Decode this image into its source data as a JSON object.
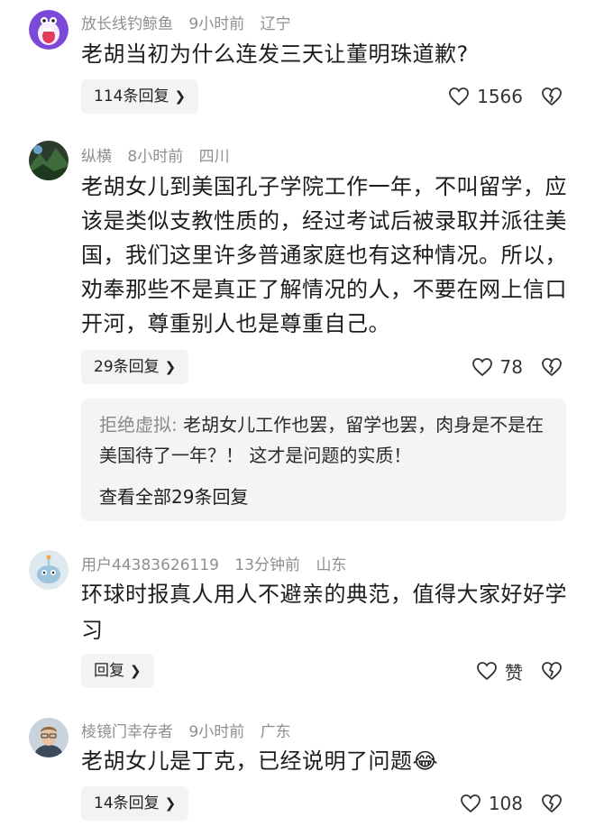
{
  "comments": [
    {
      "username": "放长线钓鲸鱼",
      "time": "9小时前",
      "location": "辽宁",
      "text": "老胡当初为什么连发三天让董明珠道歉?",
      "reply_label": "114条回复",
      "likes": "1566",
      "avatar": "purple-monster-avatar"
    },
    {
      "username": "纵横",
      "time": "8小时前",
      "location": "四川",
      "text": "老胡女儿到美国孔子学院工作一年，不叫留学，应该是类似支教性质的，经过考试后被录取并派往美国，我们这里许多普通家庭也有这种情况。所以，劝奉那些不是真正了解情况的人，不要在网上信口开河，尊重别人也是尊重自己。",
      "reply_label": "29条回复",
      "likes": "78",
      "avatar": "landscape-avatar",
      "sub_reply": {
        "author": "拒绝虚拟",
        "text": "老胡女儿工作也罢，留学也罢，肉身是不是在美国待了一年？！ 这才是问题的实质！",
        "view_all": "查看全部29条回复"
      }
    },
    {
      "username": "用户44383626119",
      "time": "13分钟前",
      "location": "山东",
      "text": "环球时报真人用人不避亲的典范，值得大家好好学习",
      "reply_label": "回复",
      "likes": "赞",
      "avatar": "default-alien-avatar"
    },
    {
      "username": "棱镜门幸存者",
      "time": "9小时前",
      "location": "广东",
      "text": "老胡女儿是丁克，已经说明了问题😂",
      "reply_label": "14条回复",
      "likes": "108",
      "avatar": "portrait-avatar"
    }
  ],
  "colors": {
    "meta": "#8f8f8f",
    "reply_bg": "#f3f3f3",
    "sub_bg": "#f4f4f4"
  }
}
